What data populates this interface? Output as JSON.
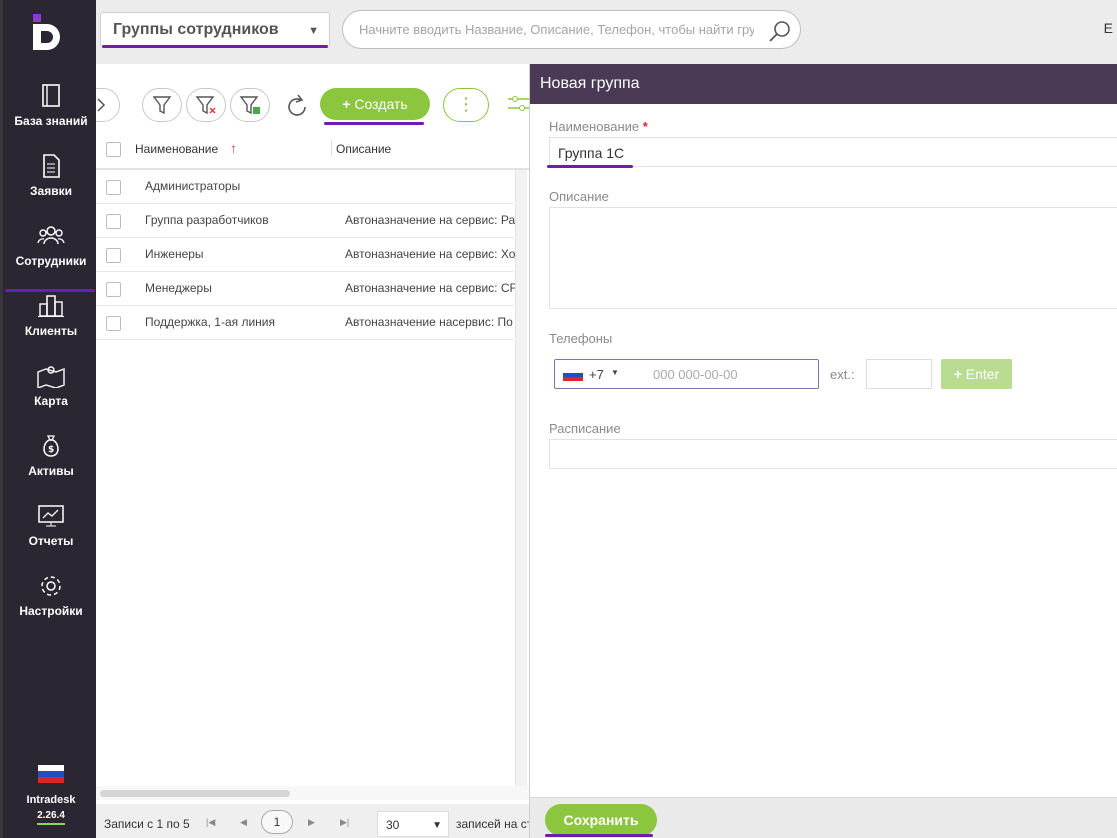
{
  "sidebar": {
    "items": [
      {
        "label": "База знаний",
        "icon": "book-icon"
      },
      {
        "label": "Заявки",
        "icon": "document-icon"
      },
      {
        "label": "Сотрудники",
        "icon": "users-icon"
      },
      {
        "label": "Клиенты",
        "icon": "buildings-icon"
      },
      {
        "label": "Карта",
        "icon": "map-icon"
      },
      {
        "label": "Активы",
        "icon": "money-bag-icon"
      },
      {
        "label": "Отчеты",
        "icon": "monitor-chart-icon"
      },
      {
        "label": "Настройки",
        "icon": "gear-icon"
      }
    ],
    "active": "Сотрудники",
    "brand": "Intradesk",
    "version": "2.26.4"
  },
  "topbar": {
    "selector": "Группы сотрудников",
    "search_placeholder": "Начните вводить Название, Описание, Телефон, чтобы найти группу",
    "corner_letter": "E"
  },
  "toolbar": {
    "create_label": "Создать",
    "more_label": "⋮"
  },
  "table": {
    "columns": [
      "Наименование",
      "Описание"
    ],
    "sort_indicator": "↑",
    "rows": [
      {
        "name": "Администраторы",
        "desc": ""
      },
      {
        "name": "Группа разработчиков",
        "desc": "Автоназначение на сервис: Ра"
      },
      {
        "name": "Инженеры",
        "desc": "Автоназначение на сервис: Хо"
      },
      {
        "name": "Менеджеры",
        "desc": "Автоназначение на сервис: CF"
      },
      {
        "name": "Поддержка, 1-ая линия",
        "desc": "Автоназначение насервис: По"
      }
    ]
  },
  "pager": {
    "records": "Записи с 1 по 5",
    "page": "1",
    "per_page": "30",
    "per_page_label": "записей на ст"
  },
  "panel": {
    "title": "Новая группа",
    "name_label": "Наименование",
    "required_mark": "*",
    "name_value": "Группа 1С",
    "desc_label": "Описание",
    "phones_label": "Телефоны",
    "country_code": "+7",
    "phone_placeholder": "000 000-00-00",
    "ext_label": "ext.:",
    "enter_label": "Enter",
    "schedule_label": "Расписание",
    "save_label": "Сохранить"
  },
  "colors": {
    "sidebar_bg": "#2b2631",
    "accent_green": "#8cc63e",
    "accent_purple": "#6a1fb0",
    "panel_header": "#4b3a56"
  }
}
